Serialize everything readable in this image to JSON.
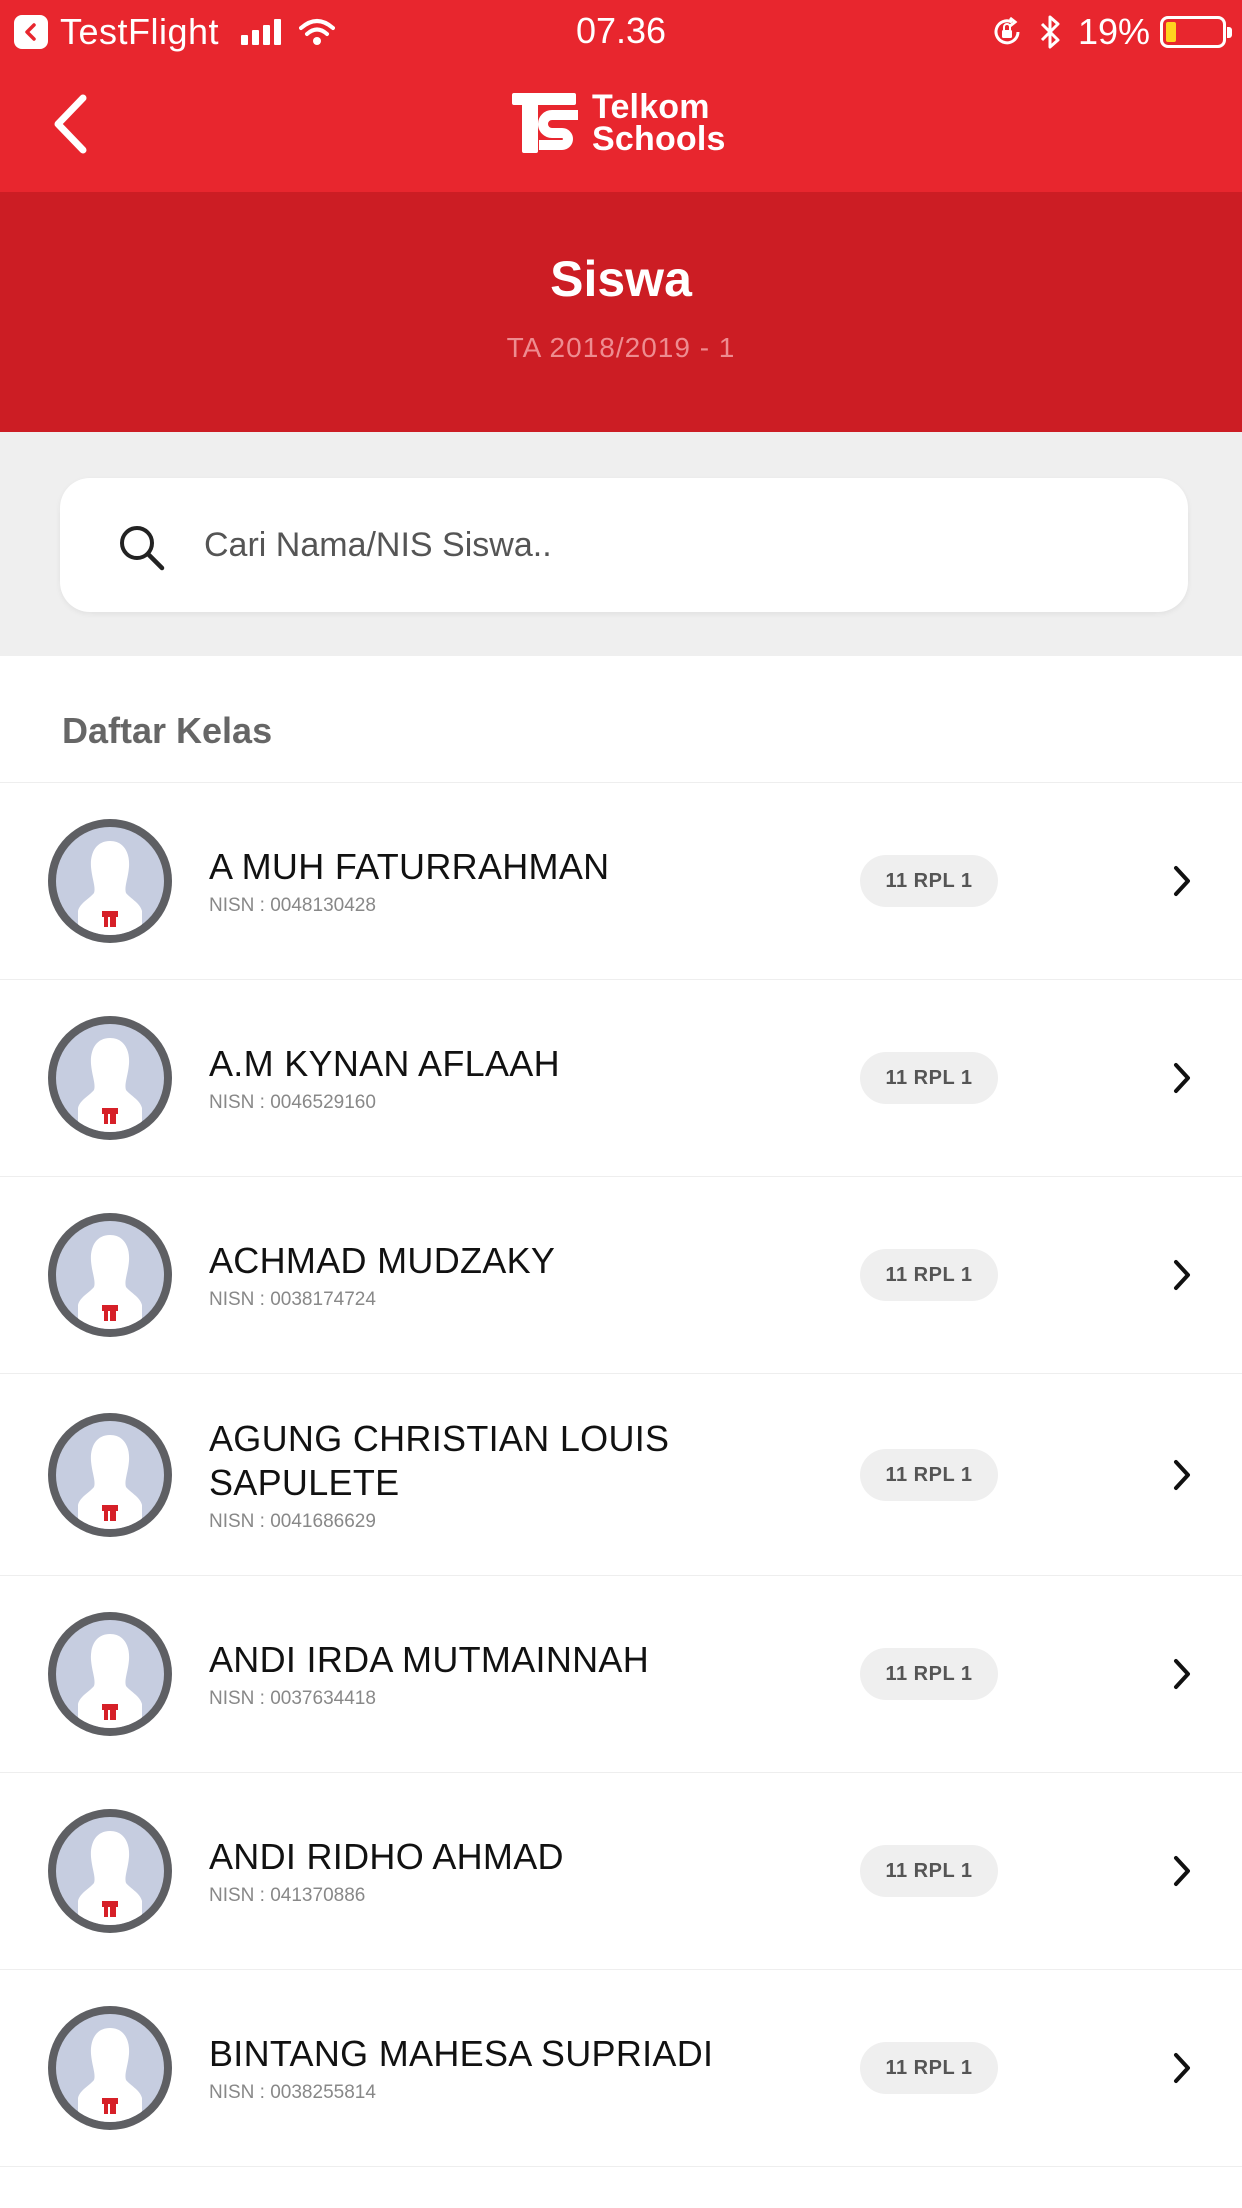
{
  "status_bar": {
    "back_app": "TestFlight",
    "time": "07.36",
    "battery_percent": "19%",
    "battery_level": 0.19,
    "icons": [
      "testflight-back-icon",
      "signal-icon",
      "wifi-icon",
      "orientation-lock-icon",
      "bluetooth-icon",
      "battery-icon"
    ]
  },
  "nav": {
    "back_icon": "chevron-left-icon",
    "logo_line1": "Telkom",
    "logo_line2": "Schools"
  },
  "header": {
    "title": "Siswa",
    "subtitle": "TA 2018/2019 - 1"
  },
  "search": {
    "placeholder": "Cari Nama/NIS Siswa..",
    "value": "",
    "icon": "search-icon"
  },
  "list": {
    "section_title": "Daftar Kelas",
    "students": [
      {
        "name": "A MUH FATURRAHMAN",
        "nisn": "NISN : 0048130428",
        "class": "11 RPL 1"
      },
      {
        "name": "A.M KYNAN AFLAAH",
        "nisn": "NISN : 0046529160",
        "class": "11 RPL 1"
      },
      {
        "name": "ACHMAD MUDZAKY",
        "nisn": "NISN : 0038174724",
        "class": "11 RPL 1"
      },
      {
        "name": "AGUNG CHRISTIAN LOUIS SAPULETE",
        "nisn": "NISN : 0041686629",
        "class": "11 RPL 1"
      },
      {
        "name": "ANDI IRDA MUTMAINNAH",
        "nisn": "NISN : 0037634418",
        "class": "11 RPL 1"
      },
      {
        "name": "ANDI RIDHO AHMAD",
        "nisn": "NISN : 041370886",
        "class": "11 RPL 1"
      },
      {
        "name": "BINTANG MAHESA SUPRIADI",
        "nisn": "NISN : 0038255814",
        "class": "11 RPL 1"
      }
    ]
  },
  "colors": {
    "primary_red": "#e8262e",
    "header_red": "#cc1d24",
    "background_gray": "#efefef"
  }
}
